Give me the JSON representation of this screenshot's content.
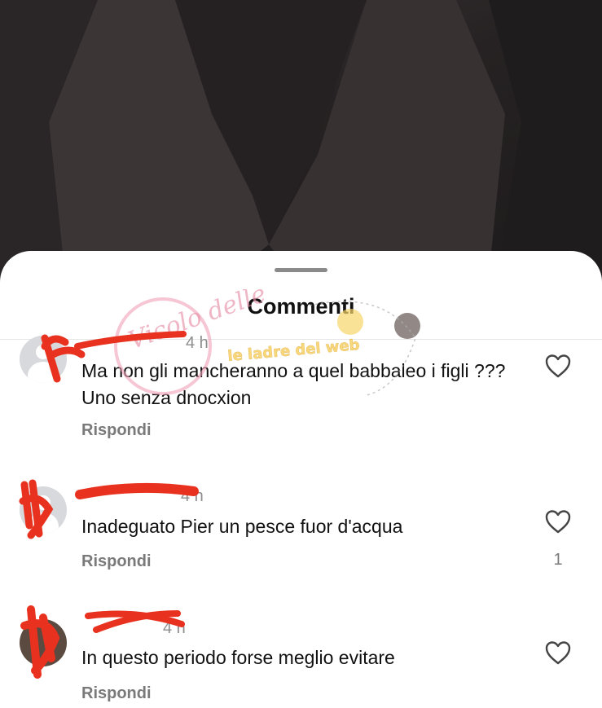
{
  "sheet": {
    "title": "Commenti"
  },
  "comments": [
    {
      "time": "4 h",
      "text": "Ma non gli mancheranno a quel babbaleo i figli ??? Uno senza dnocxion",
      "reply_label": "Rispondi",
      "likes": ""
    },
    {
      "time": "4 h",
      "text": "Inadeguato Pier un pesce fuor d'acqua",
      "reply_label": "Rispondi",
      "likes": "1"
    },
    {
      "time": "4 h",
      "text": "In questo periodo forse meglio evitare",
      "reply_label": "Rispondi",
      "likes": ""
    }
  ],
  "watermark": {
    "text": "Vicolo delle",
    "subtext": "le ladre del web"
  },
  "colors": {
    "redaction": "#e8321f",
    "background_dark": "#2b2728",
    "sheet": "#ffffff"
  }
}
